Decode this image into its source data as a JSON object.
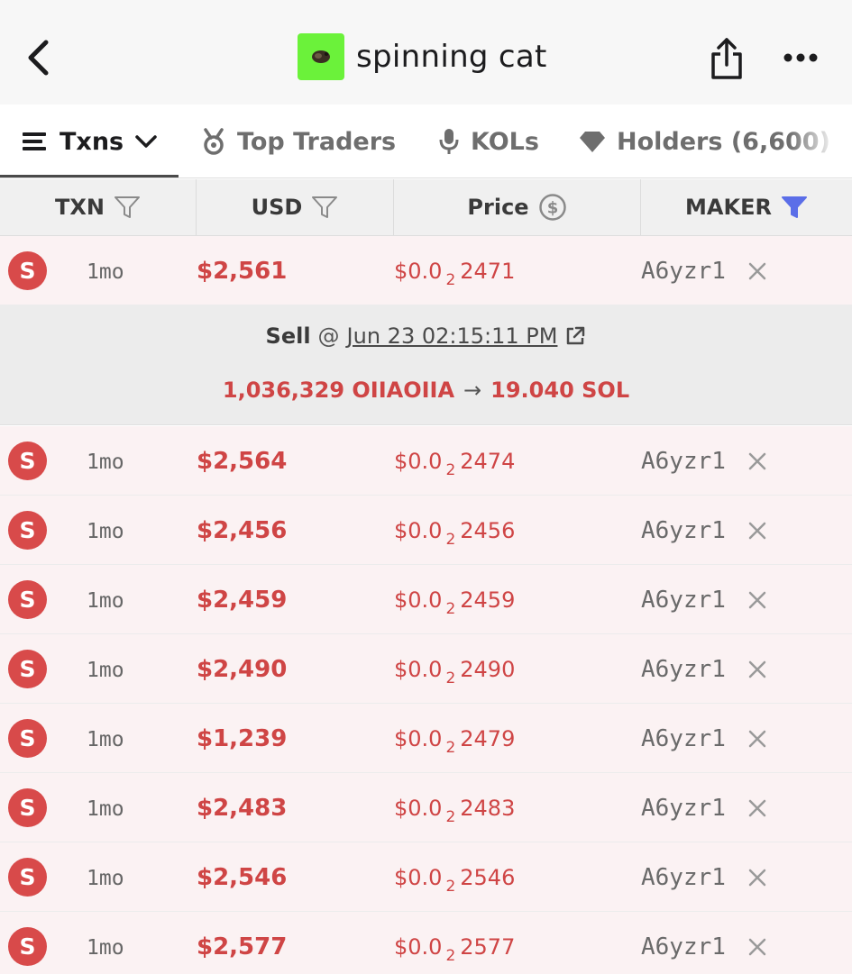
{
  "header": {
    "title": "spinning cat",
    "back_icon": "chevron-left-icon",
    "share_icon": "share-icon",
    "more_icon": "more-icon"
  },
  "tabs": [
    {
      "label": "Txns",
      "icon": "list-icon",
      "active": true
    },
    {
      "label": "Top Traders",
      "icon": "medal-icon",
      "active": false
    },
    {
      "label": "KOLs",
      "icon": "microphone-icon",
      "active": false
    },
    {
      "label": "Holders (6,600)",
      "icon": "diamond-icon",
      "active": false
    }
  ],
  "columns": [
    {
      "label": "TXN",
      "icon": "filter-icon"
    },
    {
      "label": "USD",
      "icon": "filter-icon"
    },
    {
      "label": "Price",
      "icon": "dollar-coin-icon"
    },
    {
      "label": "MAKER",
      "icon": "filter-active-icon"
    }
  ],
  "rows": [
    {
      "type": "S",
      "age": "1mo",
      "usd": "$2,561",
      "price_prefix": "$0.0",
      "price_zeros": "2",
      "price_digits": "2471",
      "maker": "A6yzr1"
    },
    {
      "type": "S",
      "age": "1mo",
      "usd": "$2,564",
      "price_prefix": "$0.0",
      "price_zeros": "2",
      "price_digits": "2474",
      "maker": "A6yzr1"
    },
    {
      "type": "S",
      "age": "1mo",
      "usd": "$2,456",
      "price_prefix": "$0.0",
      "price_zeros": "2",
      "price_digits": "2456",
      "maker": "A6yzr1"
    },
    {
      "type": "S",
      "age": "1mo",
      "usd": "$2,459",
      "price_prefix": "$0.0",
      "price_zeros": "2",
      "price_digits": "2459",
      "maker": "A6yzr1"
    },
    {
      "type": "S",
      "age": "1mo",
      "usd": "$2,490",
      "price_prefix": "$0.0",
      "price_zeros": "2",
      "price_digits": "2490",
      "maker": "A6yzr1"
    },
    {
      "type": "S",
      "age": "1mo",
      "usd": "$1,239",
      "price_prefix": "$0.0",
      "price_zeros": "2",
      "price_digits": "2479",
      "maker": "A6yzr1"
    },
    {
      "type": "S",
      "age": "1mo",
      "usd": "$2,483",
      "price_prefix": "$0.0",
      "price_zeros": "2",
      "price_digits": "2483",
      "maker": "A6yzr1"
    },
    {
      "type": "S",
      "age": "1mo",
      "usd": "$2,546",
      "price_prefix": "$0.0",
      "price_zeros": "2",
      "price_digits": "2546",
      "maker": "A6yzr1"
    },
    {
      "type": "S",
      "age": "1mo",
      "usd": "$2,577",
      "price_prefix": "$0.0",
      "price_zeros": "2",
      "price_digits": "2577",
      "maker": "A6yzr1"
    }
  ],
  "detail": {
    "action": "Sell",
    "at": "@",
    "date": "Jun 23 02:15:11 PM",
    "from_amount": "1,036,329 OIIAOIIA",
    "arrow": "→",
    "to_amount": "19.040 SOL"
  },
  "colors": {
    "sell_red": "#d84a4a",
    "row_bg": "#fbf2f3",
    "filter_active_blue": "#5b6ee8",
    "token_logo_green": "#6bf23a"
  }
}
